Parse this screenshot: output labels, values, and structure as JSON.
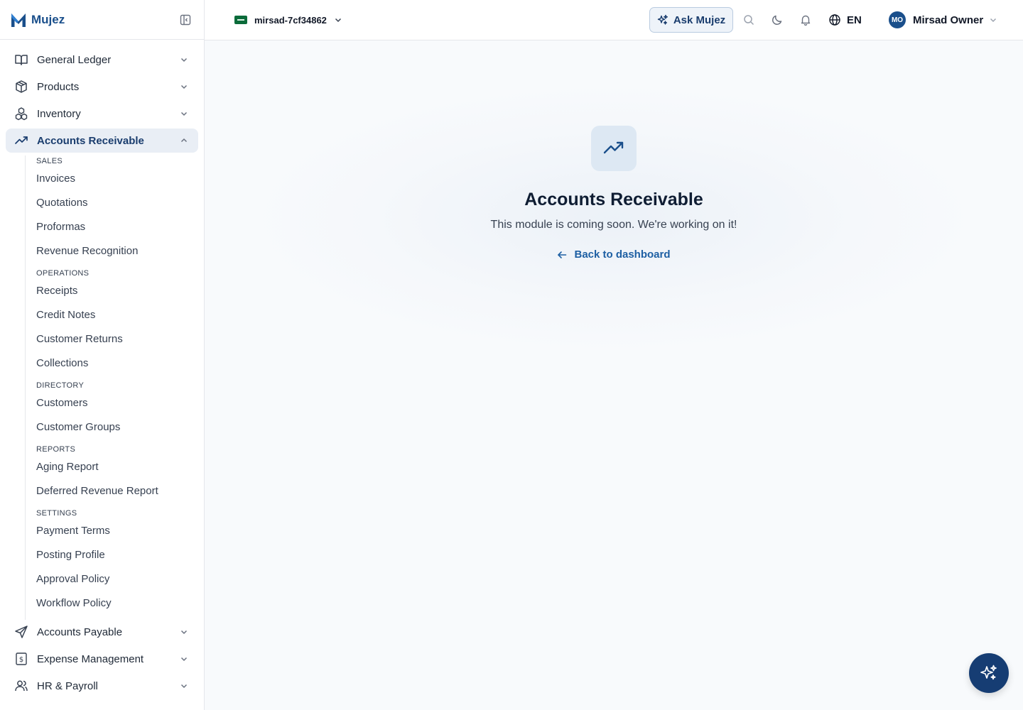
{
  "brand": {
    "name": "Mujez",
    "color": "#1a4f8b"
  },
  "topbar": {
    "org_name": "mirsad-7cf34862",
    "ask_label": "Ask Mujez",
    "language": "EN",
    "user_initials": "MO",
    "user_name": "Mirsad Owner"
  },
  "sidebar": {
    "items_top": [
      {
        "label": "General Ledger",
        "icon": "book-open-icon"
      },
      {
        "label": "Products",
        "icon": "package-icon"
      },
      {
        "label": "Inventory",
        "icon": "boxes-icon"
      },
      {
        "label": "Accounts Receivable",
        "icon": "trending-up-icon",
        "active": true
      }
    ],
    "submenu": {
      "sections": [
        {
          "title": "SALES",
          "items": [
            "Invoices",
            "Quotations",
            "Proformas",
            "Revenue Recognition"
          ]
        },
        {
          "title": "OPERATIONS",
          "items": [
            "Receipts",
            "Credit Notes",
            "Customer Returns",
            "Collections"
          ]
        },
        {
          "title": "DIRECTORY",
          "items": [
            "Customers",
            "Customer Groups"
          ]
        },
        {
          "title": "REPORTS",
          "items": [
            "Aging Report",
            "Deferred Revenue Report"
          ]
        },
        {
          "title": "SETTINGS",
          "items": [
            "Payment Terms",
            "Posting Profile",
            "Approval Policy",
            "Workflow Policy"
          ]
        }
      ]
    },
    "items_bottom": [
      {
        "label": "Accounts Payable",
        "icon": "send-icon"
      },
      {
        "label": "Expense Management",
        "icon": "receipt-dollar-icon"
      },
      {
        "label": "HR & Payroll",
        "icon": "users-icon"
      }
    ]
  },
  "main": {
    "title": "Accounts Receivable",
    "description": "This module is coming soon. We're working on it!",
    "back_label": "Back to dashboard"
  },
  "colors": {
    "accent": "#1a3d6e",
    "link": "#1d5fa3",
    "fab": "#163d73",
    "active_bg": "#e9eef5"
  }
}
